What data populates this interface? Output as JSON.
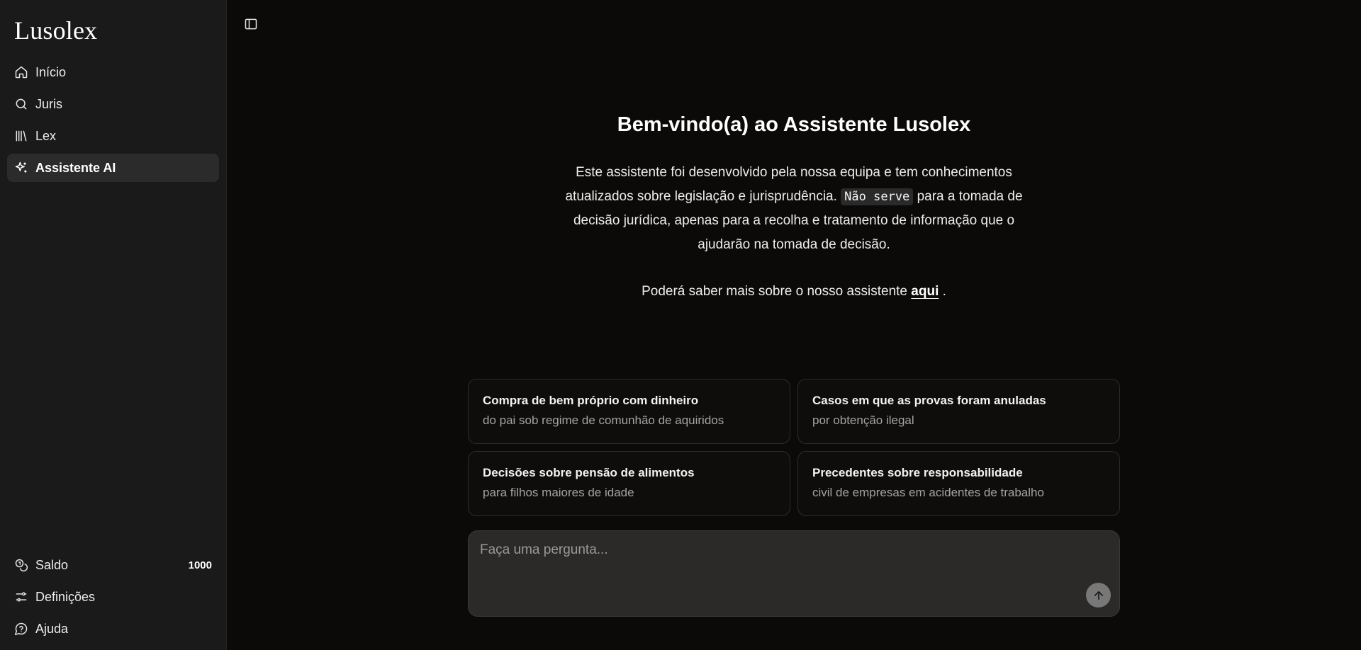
{
  "app": {
    "name": "Lusolex"
  },
  "sidebar": {
    "items": [
      {
        "label": "Início",
        "icon": "home-icon"
      },
      {
        "label": "Juris",
        "icon": "search-icon"
      },
      {
        "label": "Lex",
        "icon": "library-icon"
      },
      {
        "label": "Assistente AI",
        "icon": "sparkles-icon",
        "active": true
      }
    ],
    "bottom": {
      "balance_label": "Saldo",
      "balance_value": "1000",
      "settings_label": "Definições",
      "help_label": "Ajuda"
    }
  },
  "main": {
    "title": "Bem-vindo(a) ao Assistente Lusolex",
    "intro_before": "Este assistente foi desenvolvido pela nossa equipa e tem conhecimentos atualizados sobre legislação e jurisprudência. ",
    "intro_code": "Não serve",
    "intro_after": " para a tomada de decisão jurídica, apenas para a recolha e tratamento de informação que o ajudarão na tomada de decisão.",
    "learn_before": "Poderá saber mais sobre o nosso assistente ",
    "learn_link": "aqui",
    "learn_after": " ."
  },
  "suggestions": [
    {
      "title": "Compra de bem próprio com dinheiro",
      "subtitle": "do pai sob regime de comunhão de aquiridos"
    },
    {
      "title": "Casos em que as provas foram anuladas",
      "subtitle": "por obtenção ilegal"
    },
    {
      "title": "Decisões sobre pensão de alimentos",
      "subtitle": "para filhos maiores de idade"
    },
    {
      "title": "Precedentes sobre responsabilidade",
      "subtitle": "civil de empresas em acidentes de trabalho"
    }
  ],
  "composer": {
    "placeholder": "Faça uma pergunta..."
  },
  "colors": {
    "background": "#0b0a09",
    "sidebar": "#1a1a1b",
    "active_item": "#2b2b2c",
    "composer": "#2b2a29"
  }
}
